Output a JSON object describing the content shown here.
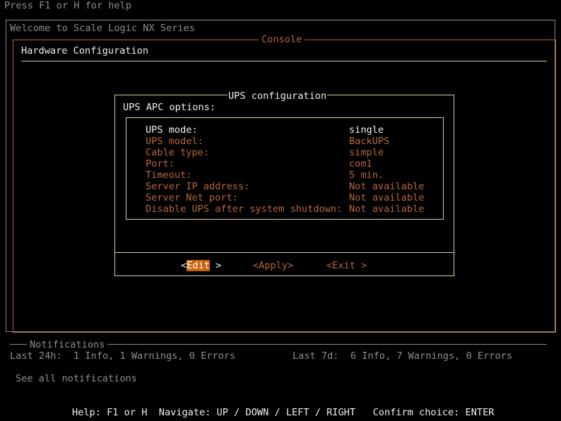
{
  "top_hint": "Press F1 or H for help",
  "welcome": "Welcome to Scale Logic NX Series",
  "console_label": "Console",
  "page_title": "Hardware Configuration",
  "dialog": {
    "title": "UPS configuration",
    "subtitle": "UPS APC options:",
    "rows": [
      {
        "label": "UPS mode:",
        "value": "single"
      },
      {
        "label": "UPS model:",
        "value": "BackUPS"
      },
      {
        "label": "Cable type:",
        "value": "simple"
      },
      {
        "label": "Port:",
        "value": "com1"
      },
      {
        "label": "Timeout:",
        "value": "5 min."
      },
      {
        "label": "Server IP address:",
        "value": "Not available"
      },
      {
        "label": "Server Net port:",
        "value": "Not available"
      },
      {
        "label": "Disable UPS after system shutdown:",
        "value": "Not available"
      }
    ],
    "buttons": {
      "edit": {
        "lt": "<",
        "label": "Edit",
        "rt": ">"
      },
      "apply": "<Apply>",
      "exit": "<Exit >"
    }
  },
  "notifications": {
    "label": "Notifications",
    "last24": "Last 24h:  1 Info, 1 Warnings, 0 Errors",
    "last7": "Last 7d:  6 Info, 7 Warnings, 0 Errors",
    "see_all": "See all notifications"
  },
  "help_bar": "Help: F1 or H  Navigate: UP / DOWN / LEFT / RIGHT   Confirm choice: ENTER",
  "colors": {
    "accent": "#b5673a",
    "selected": "#c9640c",
    "dialog_border": "#d8d2a0"
  }
}
